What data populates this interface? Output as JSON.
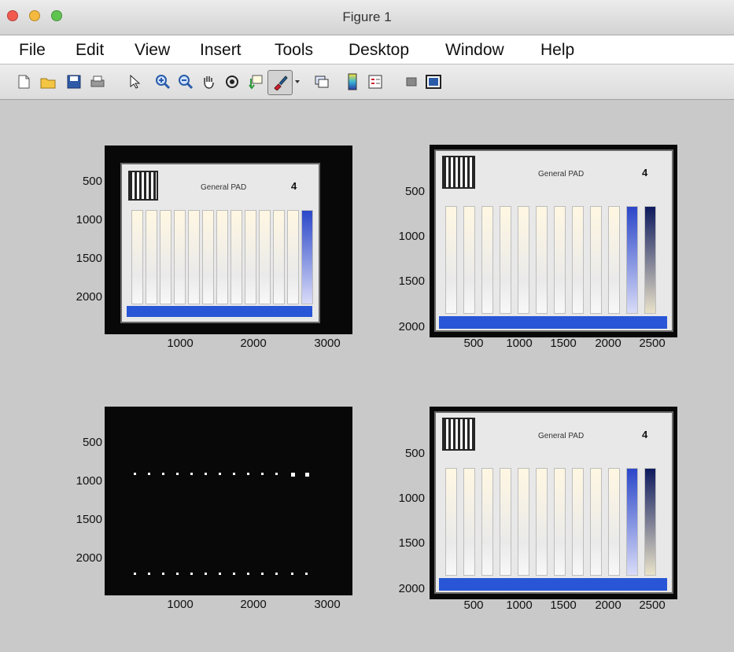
{
  "window": {
    "title": "Figure 1"
  },
  "menu": [
    "File",
    "Edit",
    "View",
    "Insert",
    "Tools",
    "Desktop",
    "Window",
    "Help"
  ],
  "toolbar": {
    "icons": [
      "new-figure-icon",
      "open-file-icon",
      "save-icon",
      "print-icon",
      "pointer-icon",
      "zoom-in-icon",
      "zoom-out-icon",
      "pan-hand-icon",
      "rotate-3d-icon",
      "data-cursor-icon",
      "brush-icon",
      "dropdown-arrow-icon",
      "link-plot-icon",
      "colorbar-icon",
      "legend-icon",
      "hide-plot-tools-icon",
      "show-plot-tools-icon"
    ]
  },
  "axes": [
    {
      "name": "top-left-axes",
      "type": "image",
      "y_ticks": [
        "500",
        "1000",
        "1500",
        "2000"
      ],
      "x_ticks": [
        "1000",
        "2000",
        "3000"
      ],
      "card_title": "General PAD",
      "card_number": "4"
    },
    {
      "name": "top-right-axes",
      "type": "image",
      "y_ticks": [
        "500",
        "1000",
        "1500",
        "2000"
      ],
      "x_ticks": [
        "500",
        "1000",
        "1500",
        "2000",
        "2500"
      ],
      "card_title": "General PAD",
      "card_number": "4"
    },
    {
      "name": "bottom-left-axes",
      "type": "binary-mask",
      "y_ticks": [
        "500",
        "1000",
        "1500",
        "2000"
      ],
      "x_ticks": [
        "1000",
        "2000",
        "3000"
      ]
    },
    {
      "name": "bottom-right-axes",
      "type": "image",
      "y_ticks": [
        "500",
        "1000",
        "1500",
        "2000"
      ],
      "x_ticks": [
        "500",
        "1000",
        "1500",
        "2000",
        "2500"
      ],
      "card_title": "General PAD",
      "card_number": "4"
    }
  ],
  "colors": {
    "plot_bg": "#080808",
    "figure_bg": "#c9c9c9",
    "card": "#e8e8e8",
    "band_blue": "#2856d6"
  }
}
